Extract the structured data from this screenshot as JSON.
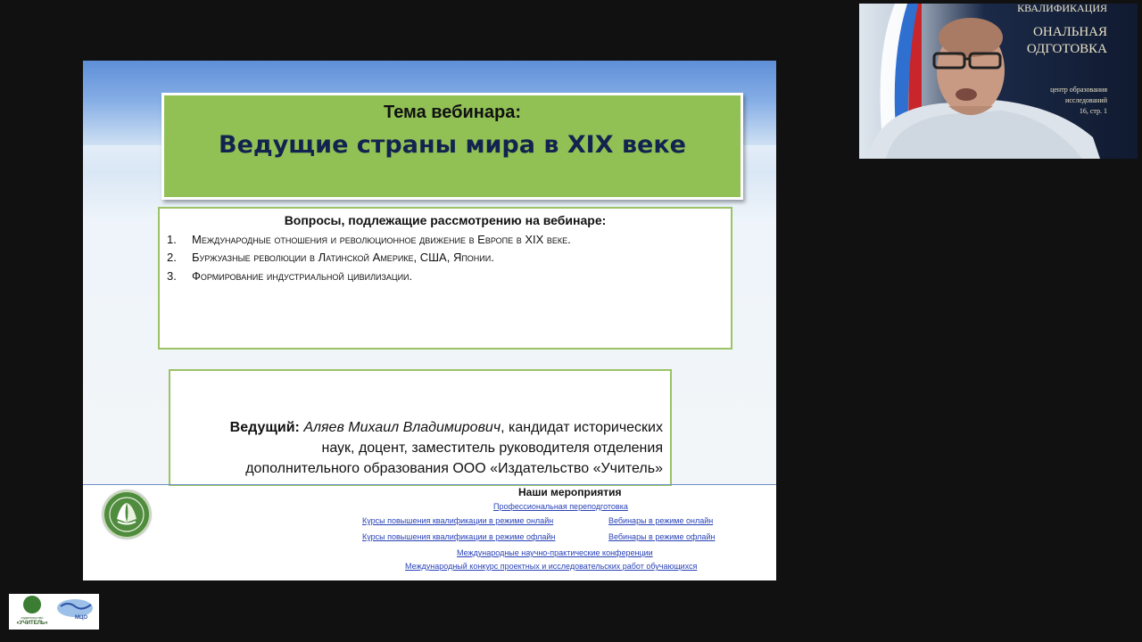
{
  "slide": {
    "title_label": "Тема вебинара:",
    "title_main": "Ведущие страны мира в XIX веке",
    "questions_heading": "Вопросы, подлежащие рассмотрению на вебинаре:",
    "questions": [
      {
        "num": "1.",
        "text": "Международные отношения и революционное движение  в Европе в XIX веке."
      },
      {
        "num": "2.",
        "text": "Буржуазные революции в Латинской Америке, США, Японии."
      },
      {
        "num": "3.",
        "text": "Формирование индустриальной цивилизации."
      }
    ],
    "presenter": {
      "label": "Ведущий:",
      "name": "Аляев Михаил Владимирович",
      "line1_rest": ", кандидат исторических",
      "line2": "наук, доцент, заместитель руководителя отделения",
      "line3": "дополнительного образования ООО «Издательство «Учитель»"
    },
    "footer": {
      "heading": "Наши мероприятия",
      "links": {
        "prof_retraining": "Профессиональная переподготовка",
        "courses_online": "Курсы повышения квалификации в режиме онлайн",
        "webinars_online": "Вебинары в режиме онлайн",
        "courses_offline": "Курсы повышения квалификации в режиме офлайн",
        "webinars_offline": "Вебинары в режиме офлайн",
        "conferences": "Международные научно-практические конференции",
        "contest": "Международный конкурс проектных и исследовательских работ обучающихся"
      }
    }
  },
  "webcam": {
    "poster_lines": [
      "КВАЛИФИКАЦИЯ",
      "ОНАЛЬНАЯ",
      "ОДГОТОВКА",
      "центр образования",
      "исследований",
      "16, стр. 1"
    ]
  },
  "corner_logo": {
    "publisher_small": "издательство",
    "publisher_name": "«УЧИТЕЛЬ»",
    "partner": "МЦО"
  },
  "colors": {
    "title_box": "#91c055",
    "title_text": "#13234f",
    "box_border": "#9bc265",
    "link": "#2a43b8",
    "background": "#111111"
  }
}
